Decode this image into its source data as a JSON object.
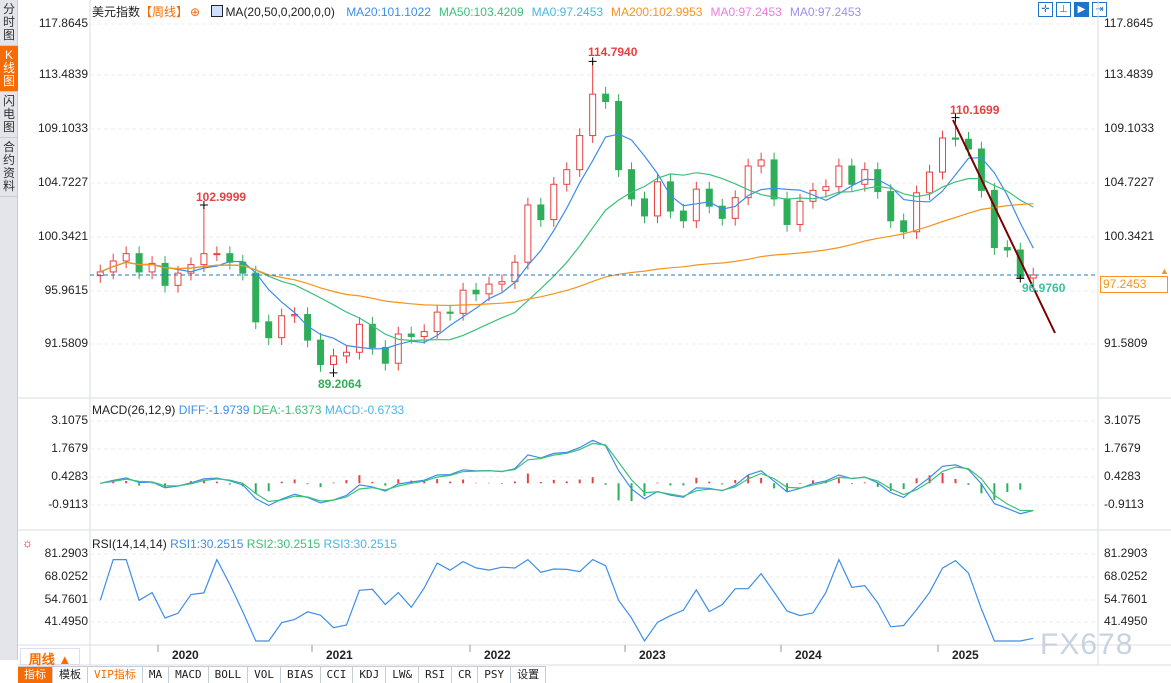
{
  "sidebar": {
    "tabs": [
      {
        "label": "分时图"
      },
      {
        "label": "K线图",
        "active": true
      },
      {
        "label": "闪电图"
      },
      {
        "label": "合约资料"
      }
    ]
  },
  "header": {
    "symbol": "美元指数",
    "period": "【周线】",
    "indicator": "MA(20,50,0,200,0,0)",
    "ma_values": [
      {
        "text": "MA20:101.1022",
        "color": "#3d8ee8"
      },
      {
        "text": "MA50:103.4209",
        "color": "#3cc07a"
      },
      {
        "text": "MA0:97.2453",
        "color": "#46b7e8"
      },
      {
        "text": "MA200:102.9953",
        "color": "#f7931e"
      },
      {
        "text": "MA0:97.2453",
        "color": "#e77fd8"
      },
      {
        "text": "MA0:97.2453",
        "color": "#9b8ff0"
      }
    ],
    "tool_icons": [
      "crosshair-icon",
      "zoom-fit-icon",
      "play-icon",
      "exit-icon"
    ]
  },
  "annotations": {
    "high1": "114.7940",
    "high2": "102.9999",
    "low1": "89.2064",
    "high3": "110.1699",
    "low2": "96.9760",
    "current": "97.2453"
  },
  "period_button": "周线 ▲",
  "toolbar": [
    "指标",
    "模板",
    "VIP指标",
    "MA",
    "MACD",
    "BOLL",
    "VOL",
    "BIAS",
    "CCI",
    "KDJ",
    "LW&",
    "RSI",
    "CR",
    "PSY",
    "设置"
  ],
  "watermark": "FX678",
  "colors": {
    "up": "#e84040",
    "down": "#2fae5a",
    "ma20": "#3d8ee8",
    "ma50": "#3cc07a",
    "ma200": "#f7931e",
    "trendline": "#7a0000",
    "current_line": "#1f74c9"
  },
  "chart_data": [
    {
      "type": "candlestick",
      "title": "美元指数 周线",
      "y_ticks": [
        "117.8645",
        "113.4839",
        "109.1033",
        "104.7227",
        "100.3421",
        "95.9615",
        "91.5809"
      ],
      "ylim": [
        91.5809,
        117.8645
      ],
      "x_ticks": [
        "2020",
        "2021",
        "2022",
        "2023",
        "2024",
        "2025"
      ],
      "dates": [
        "2019-07",
        "2019-08",
        "2019-09",
        "2019-10",
        "2019-11",
        "2019-12",
        "2020-01",
        "2020-02",
        "2020-03",
        "2020-04",
        "2020-05",
        "2020-06",
        "2020-07",
        "2020-08",
        "2020-09",
        "2020-10",
        "2020-11",
        "2020-12",
        "2021-01",
        "2021-02",
        "2021-03",
        "2021-04",
        "2021-05",
        "2021-06",
        "2021-07",
        "2021-08",
        "2021-09",
        "2021-10",
        "2021-11",
        "2021-12",
        "2022-01",
        "2022-02",
        "2022-03",
        "2022-04",
        "2022-05",
        "2022-06",
        "2022-07",
        "2022-08",
        "2022-09",
        "2022-10",
        "2022-11",
        "2022-12",
        "2023-01",
        "2023-02",
        "2023-03",
        "2023-04",
        "2023-05",
        "2023-06",
        "2023-07",
        "2023-08",
        "2023-09",
        "2023-10",
        "2023-11",
        "2023-12",
        "2024-01",
        "2024-02",
        "2024-03",
        "2024-04",
        "2024-05",
        "2024-06",
        "2024-07",
        "2024-08",
        "2024-09",
        "2024-10",
        "2024-11",
        "2024-12",
        "2025-01",
        "2025-02",
        "2025-03",
        "2025-04",
        "2025-05",
        "2025-06",
        "2025-07"
      ],
      "close": [
        97.5,
        98.4,
        99.0,
        97.5,
        98.2,
        96.4,
        97.4,
        98.1,
        99.0,
        99.0,
        98.3,
        97.4,
        93.4,
        92.1,
        93.9,
        94.0,
        91.9,
        89.9,
        90.6,
        90.9,
        93.2,
        91.3,
        90.0,
        92.4,
        92.2,
        92.6,
        94.2,
        94.1,
        96.0,
        95.7,
        96.5,
        96.7,
        98.3,
        103.0,
        101.8,
        104.7,
        105.9,
        108.7,
        112.1,
        111.5,
        105.9,
        103.5,
        102.1,
        104.9,
        102.5,
        101.7,
        104.3,
        102.9,
        101.9,
        103.6,
        106.2,
        106.7,
        103.5,
        101.4,
        103.3,
        104.2,
        104.5,
        106.2,
        104.7,
        105.9,
        104.1,
        101.7,
        100.8,
        104.0,
        105.7,
        108.5,
        108.4,
        107.6,
        104.2,
        99.5,
        99.3,
        97.0,
        97.25
      ],
      "marked_extremes": [
        {
          "date": "2020-03",
          "high": 102.9999
        },
        {
          "date": "2021-01",
          "low": 89.2064
        },
        {
          "date": "2022-09",
          "high": 114.794
        },
        {
          "date": "2025-01",
          "high": 110.1699
        },
        {
          "date": "2025-06",
          "low": 96.976
        }
      ],
      "current_price": 97.2453
    },
    {
      "type": "line",
      "title": "MACD(26,12,9)",
      "series": [
        {
          "name": "DIFF",
          "last": -1.9739
        },
        {
          "name": "DEA",
          "last": -1.6373
        },
        {
          "name": "MACD",
          "last": -0.6733
        }
      ],
      "labels": [
        "DIFF:-1.9739",
        "DEA:-1.6373",
        "MACD:-0.6733"
      ],
      "y_ticks": [
        "3.1075",
        "1.7679",
        "0.4283",
        "-0.9113"
      ]
    },
    {
      "type": "line",
      "title": "RSI(14,14,14)",
      "series": [
        {
          "name": "RSI1",
          "last": 30.2515
        },
        {
          "name": "RSI2",
          "last": 30.2515
        },
        {
          "name": "RSI3",
          "last": 30.2515
        }
      ],
      "labels": [
        "RSI1:30.2515",
        "RSI2:30.2515",
        "RSI3:30.2515"
      ],
      "y_ticks": [
        "81.2903",
        "68.0252",
        "54.7601",
        "41.4950"
      ]
    }
  ]
}
